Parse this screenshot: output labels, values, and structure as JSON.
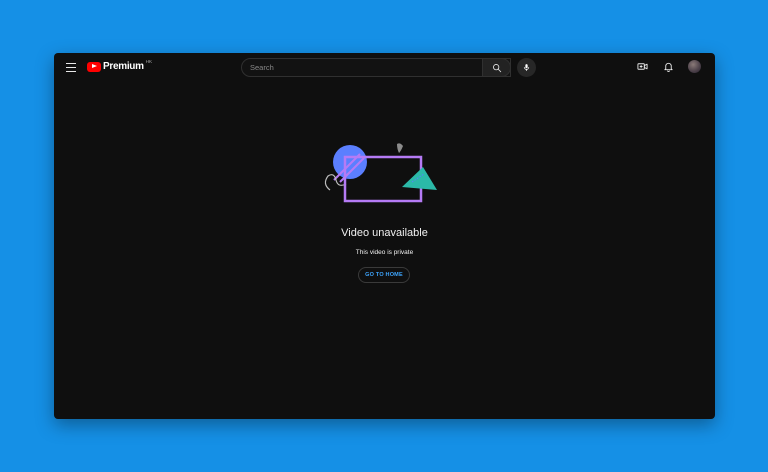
{
  "header": {
    "logo_text": "Premium",
    "logo_region": "HK",
    "search_placeholder": "Search"
  },
  "icons": {
    "menu": "hamburger-menu-icon",
    "search": "search-icon",
    "mic": "microphone-icon",
    "create": "create-video-icon",
    "notifications": "bell-icon",
    "avatar": "avatar"
  },
  "error": {
    "title": "Video unavailable",
    "subtitle": "This video is private",
    "button_label": "GO TO HOME"
  },
  "colors": {
    "background": "#1590e6",
    "window": "#0f0f0f",
    "brand_red": "#ff0000",
    "link_blue": "#3ea6ff",
    "frame_purple": "#b57bf5",
    "circle_blue": "#5b7fff",
    "triangle_teal": "#2bb9a8"
  }
}
